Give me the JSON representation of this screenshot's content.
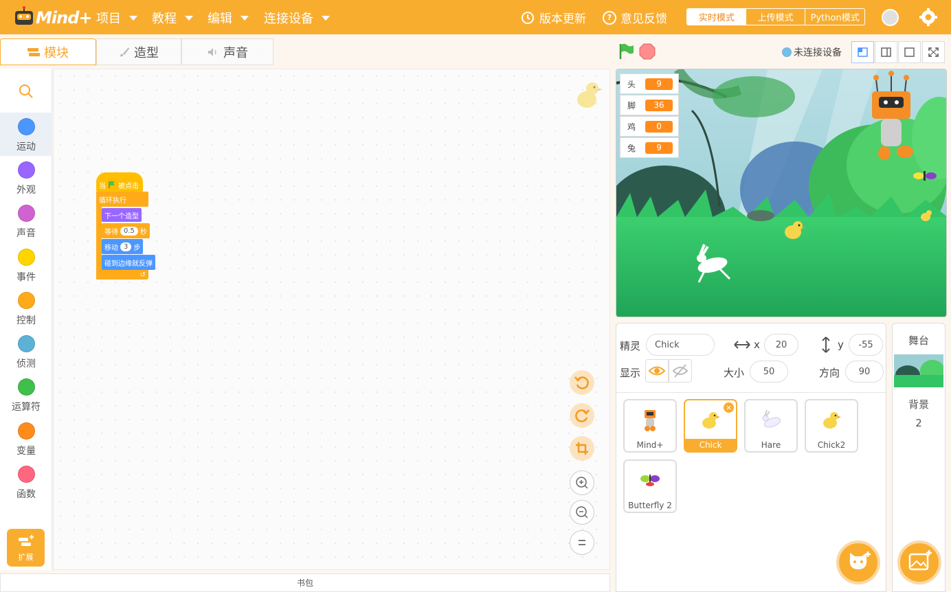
{
  "app": {
    "logo_text": "Mind+",
    "menu": [
      "项目",
      "教程",
      "编辑",
      "连接设备"
    ],
    "update_label": "版本更新",
    "feedback_label": "意见反馈",
    "modes": [
      "实时模式",
      "上传模式",
      "Python模式"
    ],
    "active_mode": "实时模式"
  },
  "tabs": [
    "模块",
    "造型",
    "声音"
  ],
  "categories": [
    {
      "label": "运动",
      "color": "#4c97ff"
    },
    {
      "label": "外观",
      "color": "#9966ff"
    },
    {
      "label": "声音",
      "color": "#cf63cf"
    },
    {
      "label": "事件",
      "color": "#ffd500"
    },
    {
      "label": "控制",
      "color": "#ffab19"
    },
    {
      "label": "侦测",
      "color": "#5cb1d6"
    },
    {
      "label": "运算符",
      "color": "#40bf4a"
    },
    {
      "label": "变量",
      "color": "#ff8c1a"
    },
    {
      "label": "函数",
      "color": "#ff6680"
    }
  ],
  "extension_label": "扩展",
  "script": {
    "hat_when": "当",
    "hat_clicked": "被点击",
    "forever": "循环执行",
    "next_costume": "下一个造型",
    "wait_label": "等待",
    "wait_value": "0.5",
    "wait_unit": "秒",
    "move_label": "移动",
    "move_value": "3",
    "move_unit": "步",
    "bounce": "碰到边缘就反弹"
  },
  "backpack_label": "书包",
  "device_status": "未连接设备",
  "monitors": [
    {
      "label": "头",
      "value": "9"
    },
    {
      "label": "脚",
      "value": "36"
    },
    {
      "label": "鸡",
      "value": "0"
    },
    {
      "label": "兔",
      "value": "9"
    }
  ],
  "sprite_info": {
    "sprite_label": "精灵",
    "name": "Chick",
    "x_label": "x",
    "x": "20",
    "y_label": "y",
    "y": "-55",
    "show_label": "显示",
    "size_label": "大小",
    "size": "50",
    "direction_label": "方向",
    "direction": "90"
  },
  "sprites": [
    "Mind+",
    "Chick",
    "Hare",
    "Chick2",
    "Butterfly 2"
  ],
  "selected_sprite": "Chick",
  "stage_panel": {
    "title": "舞台",
    "backdrop_label": "背景",
    "backdrop_count": "2"
  },
  "colors": {
    "brand": "#f9ad2f",
    "monitor_value": "#ff8c1a"
  }
}
